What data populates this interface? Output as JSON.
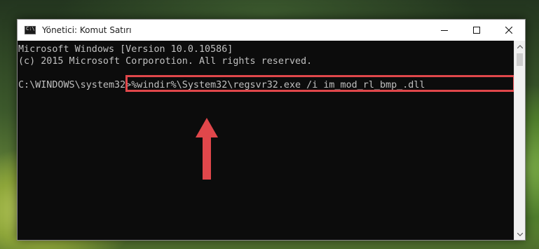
{
  "window": {
    "title": "Yönetici: Komut Satırı"
  },
  "console": {
    "line1": "Microsoft Windows [Version 10.0.10586]",
    "line2": "(c) 2015 Microsoft Corporotion. All rights reserved.",
    "prompt": "C:\\WINDOWS\\system32>",
    "command": "%windir%\\System32\\regsvr32.exe /i im_mod_rl_bmp_.dll"
  },
  "colors": {
    "console_bg": "#0c0c0c",
    "console_text": "#c0c0c0",
    "highlight": "#e0474b"
  },
  "icons": [
    "cmd-app-icon",
    "minimize-icon",
    "maximize-icon",
    "close-icon",
    "scroll-up-icon",
    "scroll-down-icon",
    "arrow-up-icon"
  ]
}
